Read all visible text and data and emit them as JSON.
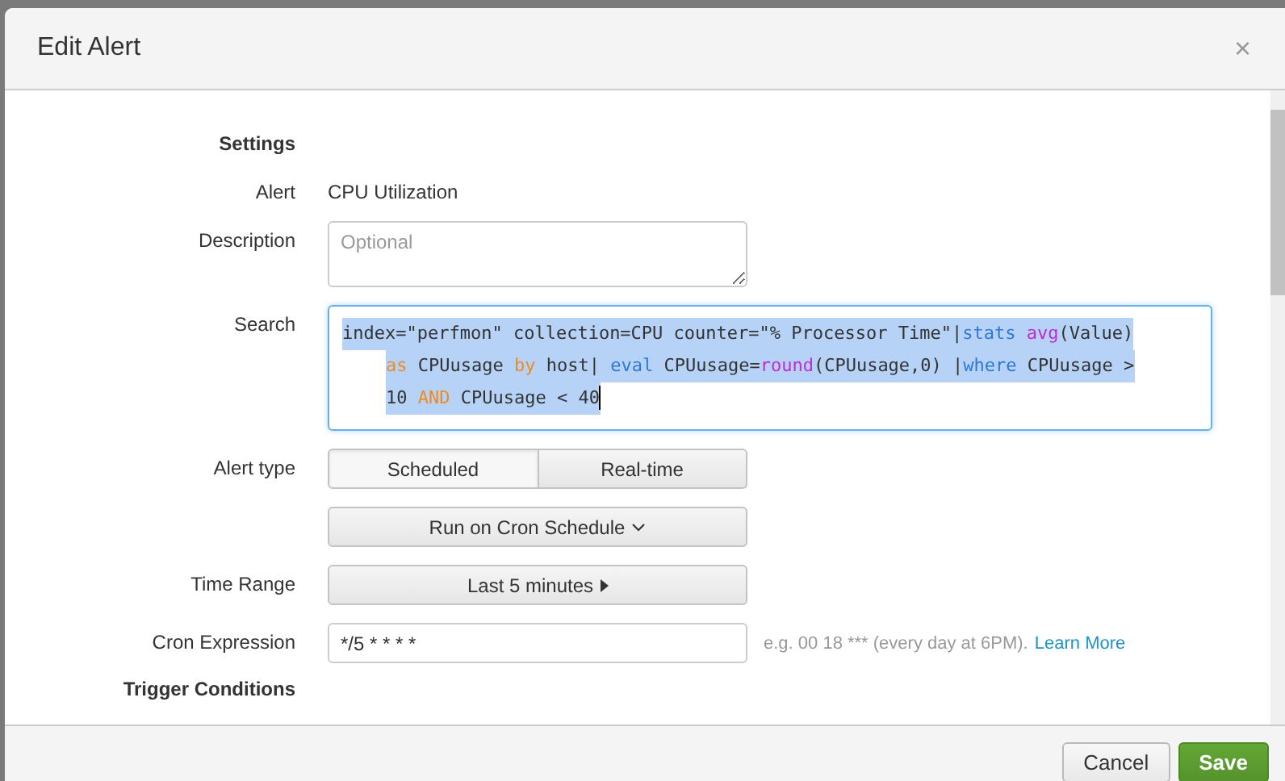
{
  "dialog": {
    "title": "Edit Alert",
    "close": "×"
  },
  "form": {
    "section": "Settings",
    "alert": {
      "label": "Alert",
      "value": "CPU Utilization"
    },
    "description": {
      "label": "Description",
      "placeholder": "Optional"
    },
    "search": {
      "label": "Search",
      "selected": true,
      "lines": [
        [
          {
            "kind": "plain",
            "text": "index=\"perfmon\" collection=CPU counter=\"% Processor Time\"|"
          },
          {
            "kind": "command",
            "text": "stats"
          },
          {
            "kind": "function",
            "text": " avg"
          },
          {
            "kind": "plain",
            "text": "(Value)"
          }
        ],
        [
          {
            "kind": "keyword",
            "text": "as"
          },
          {
            "kind": "plain",
            "text": " CPUusage "
          },
          {
            "kind": "keyword",
            "text": "by"
          },
          {
            "kind": "plain",
            "text": " host| "
          },
          {
            "kind": "command",
            "text": "eval"
          },
          {
            "kind": "plain",
            "text": " CPUusage="
          },
          {
            "kind": "function",
            "text": "round"
          },
          {
            "kind": "plain",
            "text": "(CPUusage,0) |"
          },
          {
            "kind": "command",
            "text": "where"
          },
          {
            "kind": "plain",
            "text": " CPUusage >"
          }
        ],
        [
          {
            "kind": "plain",
            "text": "10 "
          },
          {
            "kind": "keyword",
            "text": "AND"
          },
          {
            "kind": "plain",
            "text": " CPUusage < 40"
          }
        ]
      ]
    },
    "alert_type": {
      "label": "Alert type",
      "options": [
        {
          "label": "Scheduled",
          "selected": true
        },
        {
          "label": "Real-time",
          "selected": false
        }
      ]
    },
    "schedule": {
      "value": "Run on Cron Schedule"
    },
    "time_range": {
      "label": "Time Range",
      "value": "Last 5 minutes"
    },
    "cron": {
      "label": "Cron Expression",
      "value": "*/5 * * * *",
      "help": "e.g. 00 18 *** (every day at 6PM).",
      "link": "Learn More"
    },
    "next_section": "Trigger Conditions"
  },
  "buttons": [
    {
      "label": "Cancel",
      "kind": "secondary"
    },
    {
      "label": "Save",
      "kind": "primary"
    }
  ]
}
